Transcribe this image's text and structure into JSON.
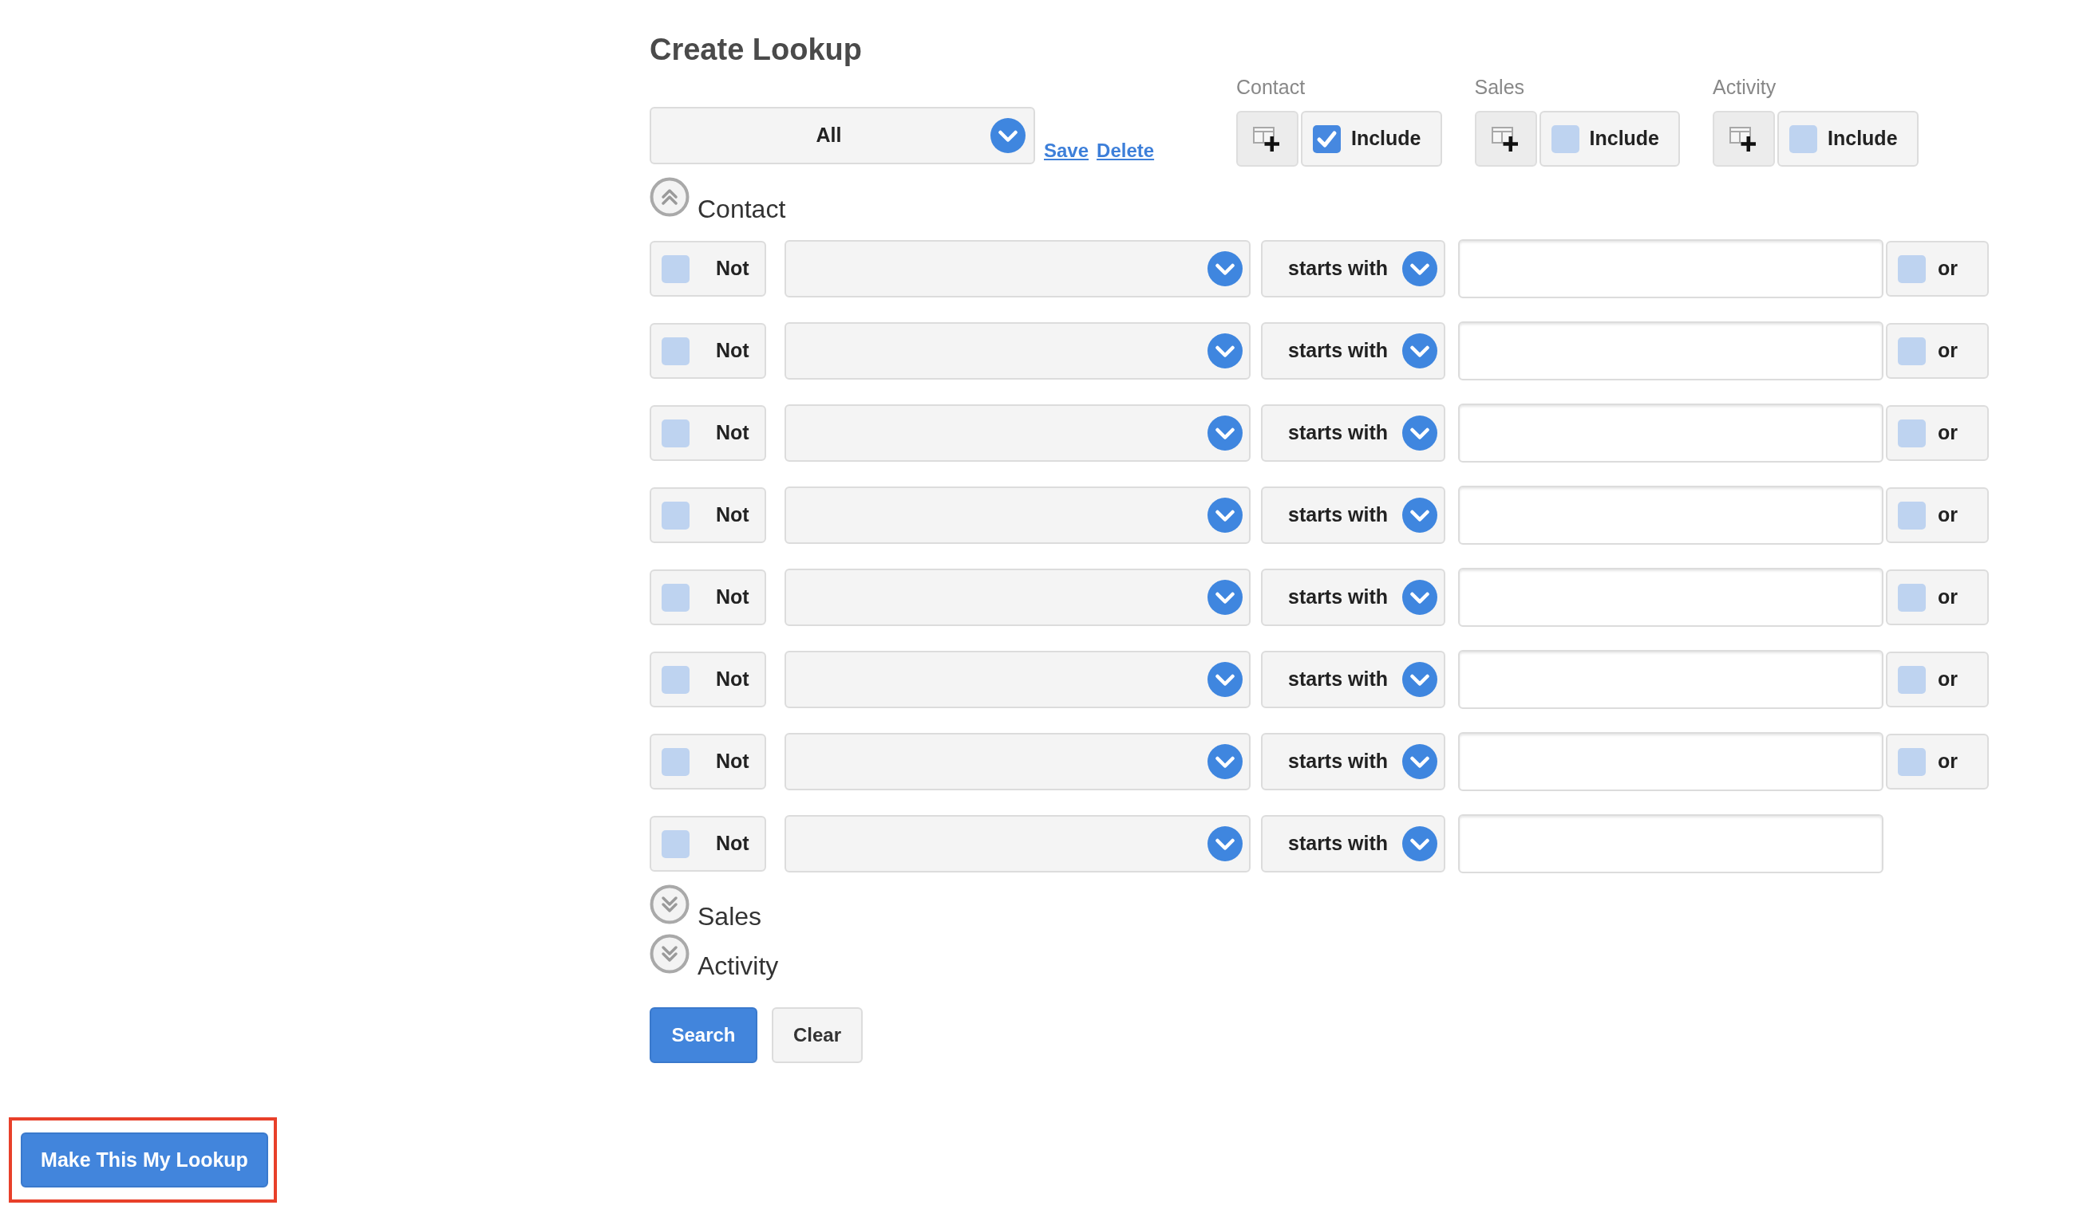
{
  "title": "Create Lookup",
  "lookup_dropdown": {
    "value": "All"
  },
  "links": [
    {
      "label": "Save"
    },
    {
      "label": "Delete"
    }
  ],
  "include_groups": [
    {
      "label": "Contact",
      "button_label": "Include",
      "checked": true
    },
    {
      "label": "Sales",
      "button_label": "Include",
      "checked": false
    },
    {
      "label": "Activity",
      "button_label": "Include",
      "checked": false
    }
  ],
  "sections": [
    {
      "title": "Contact",
      "expanded": true,
      "rows": [
        {
          "not_label": "Not",
          "not_checked": false,
          "operator": "starts with",
          "or_label": "or",
          "or_checked": false
        },
        {
          "not_label": "Not",
          "not_checked": false,
          "operator": "starts with",
          "or_label": "or",
          "or_checked": false
        },
        {
          "not_label": "Not",
          "not_checked": false,
          "operator": "starts with",
          "or_label": "or",
          "or_checked": false
        },
        {
          "not_label": "Not",
          "not_checked": false,
          "operator": "starts with",
          "or_label": "or",
          "or_checked": false
        },
        {
          "not_label": "Not",
          "not_checked": false,
          "operator": "starts with",
          "or_label": "or",
          "or_checked": false
        },
        {
          "not_label": "Not",
          "not_checked": false,
          "operator": "starts with",
          "or_label": "or",
          "or_checked": false
        },
        {
          "not_label": "Not",
          "not_checked": false,
          "operator": "starts with",
          "or_label": "or",
          "or_checked": false
        },
        {
          "not_label": "Not",
          "not_checked": false,
          "operator": "starts with"
        }
      ]
    },
    {
      "title": "Sales",
      "expanded": false
    },
    {
      "title": "Activity",
      "expanded": false
    }
  ],
  "buttons": [
    {
      "label": "Search",
      "kind": "primary"
    },
    {
      "label": "Clear",
      "kind": "secondary"
    }
  ],
  "footer_button": {
    "label": "Make This My Lookup",
    "highlighted": true
  }
}
